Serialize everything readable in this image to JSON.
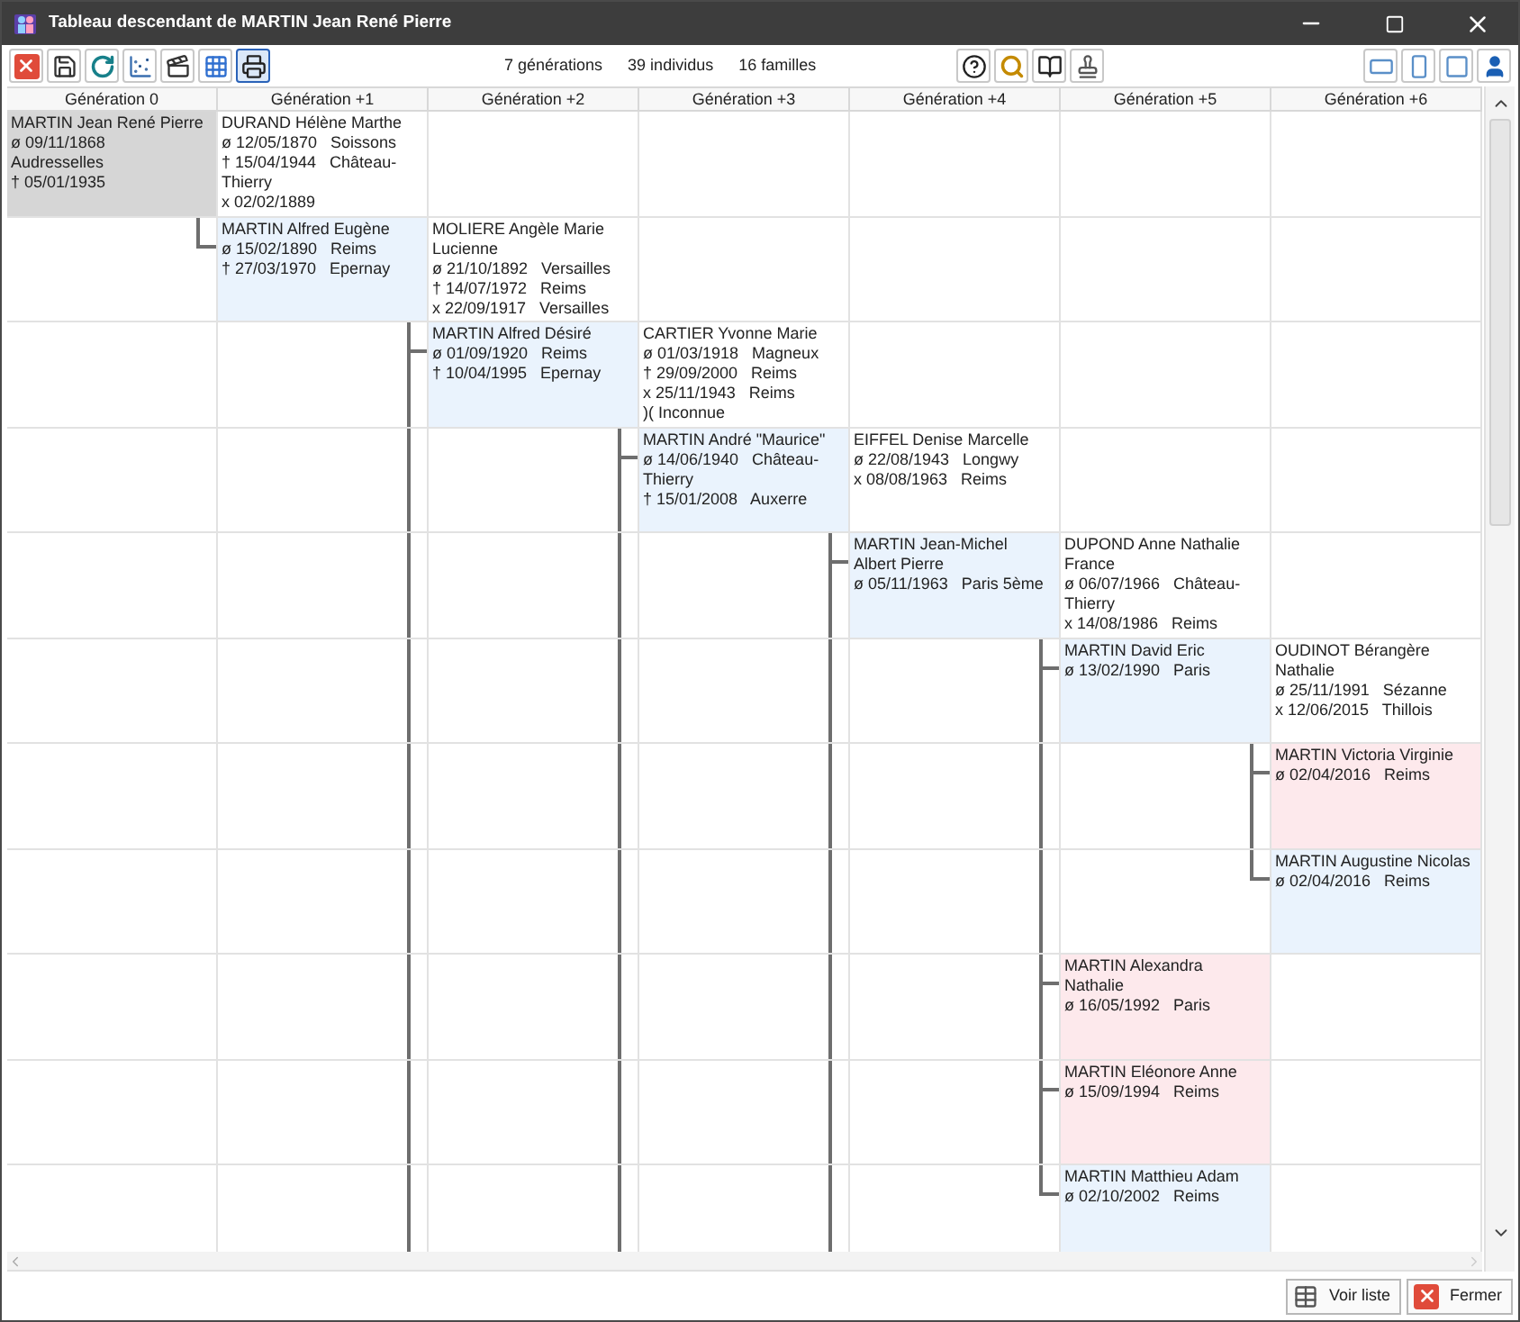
{
  "window": {
    "title": "Tableau descendant de MARTIN Jean René Pierre"
  },
  "toolbar": {
    "left": [
      {
        "pressed": false
      },
      {
        "pressed": false
      },
      {
        "pressed": false
      },
      {
        "pressed": false
      },
      {
        "pressed": false
      },
      {
        "pressed": false
      },
      {
        "pressed": true
      }
    ],
    "center": [
      {
        "pressed": false
      },
      {
        "pressed": false
      },
      {
        "pressed": false
      },
      {
        "pressed": false
      }
    ],
    "right": [
      {
        "pressed": false
      },
      {
        "pressed": false
      },
      {
        "pressed": false
      },
      {
        "pressed": false
      }
    ]
  },
  "stats": [
    "7 générations",
    "39 individus",
    "16 familles"
  ],
  "columns": [
    "Génération 0",
    "Génération +1",
    "Génération +2",
    "Génération +3",
    "Génération +4",
    "Génération +5",
    "Génération +6"
  ],
  "tree": {
    "name": "MARTIN Jean René Pierre",
    "kind": "male",
    "selected": true,
    "more_children": false,
    "events": [
      "ø 09/11/1868   Audresselles",
      "† 05/01/1935"
    ],
    "spouse": {
      "name": "DURAND Hélène Marthe",
      "events": [
        "ø 12/05/1870   Soissons",
        "† 15/04/1944   Château-Thierry",
        "x 02/02/1889"
      ]
    },
    "children": [
      {
        "name": "MARTIN Alfred Eugène",
        "kind": "male",
        "selected": false,
        "more_children": true,
        "events": [
          "ø 15/02/1890   Reims",
          "† 27/03/1970   Epernay"
        ],
        "spouse": {
          "name": "MOLIERE Angèle Marie Lucienne",
          "events": [
            "ø 21/10/1892   Versailles",
            "† 14/07/1972   Reims",
            "x 22/09/1917   Versailles"
          ]
        },
        "children": [
          {
            "name": "MARTIN Alfred Désiré",
            "kind": "male",
            "selected": false,
            "more_children": true,
            "events": [
              "ø 01/09/1920   Reims",
              "† 10/04/1995   Epernay"
            ],
            "spouse": {
              "name": "CARTIER Yvonne Marie",
              "events": [
                "ø 01/03/1918   Magneux",
                "† 29/09/2000   Reims",
                "x 25/11/1943   Reims",
                ")( Inconnue"
              ]
            },
            "children": [
              {
                "name": "MARTIN André \"Maurice\"",
                "kind": "male",
                "selected": false,
                "more_children": true,
                "events": [
                  "ø 14/06/1940   Château-Thierry",
                  "† 15/01/2008   Auxerre"
                ],
                "spouse": {
                  "name": "EIFFEL Denise Marcelle",
                  "events": [
                    "ø 22/08/1943   Longwy",
                    "x 08/08/1963   Reims"
                  ]
                },
                "children": [
                  {
                    "name": "MARTIN Jean-Michel Albert Pierre",
                    "kind": "male",
                    "selected": false,
                    "more_children": false,
                    "events": [
                      "ø 05/11/1963   Paris 5ème"
                    ],
                    "spouse": {
                      "name": "DUPOND Anne Nathalie France",
                      "events": [
                        "ø 06/07/1966   Château-Thierry",
                        "x 14/08/1986   Reims"
                      ]
                    },
                    "children": [
                      {
                        "name": "MARTIN David Eric",
                        "kind": "male",
                        "selected": false,
                        "more_children": false,
                        "events": [
                          "ø 13/02/1990   Paris"
                        ],
                        "spouse": {
                          "name": "OUDINOT Bérangère Nathalie",
                          "events": [
                            "ø 25/11/1991   Sézanne",
                            "x 12/06/2015   Thillois"
                          ]
                        },
                        "children": [
                          {
                            "name": "MARTIN Victoria Virginie",
                            "kind": "female",
                            "selected": false,
                            "events": [
                              "ø 02/04/2016   Reims"
                            ]
                          },
                          {
                            "name": "MARTIN Augustine Nicolas",
                            "kind": "male",
                            "selected": false,
                            "events": [
                              "ø 02/04/2016   Reims"
                            ]
                          }
                        ]
                      },
                      {
                        "name": "MARTIN Alexandra Nathalie",
                        "kind": "female",
                        "selected": false,
                        "events": [
                          "ø 16/05/1992   Paris"
                        ]
                      },
                      {
                        "name": "MARTIN Eléonore Anne",
                        "kind": "female",
                        "selected": false,
                        "events": [
                          "ø 15/09/1994   Reims"
                        ]
                      },
                      {
                        "name": "MARTIN Matthieu Adam",
                        "kind": "male",
                        "selected": false,
                        "events": [
                          "ø 02/10/2002   Reims"
                        ]
                      }
                    ]
                  }
                ]
              }
            ]
          }
        ]
      }
    ]
  },
  "footer": [
    {
      "kind": "list",
      "label": "Voir liste"
    },
    {
      "kind": "close",
      "label": "Fermer"
    }
  ]
}
